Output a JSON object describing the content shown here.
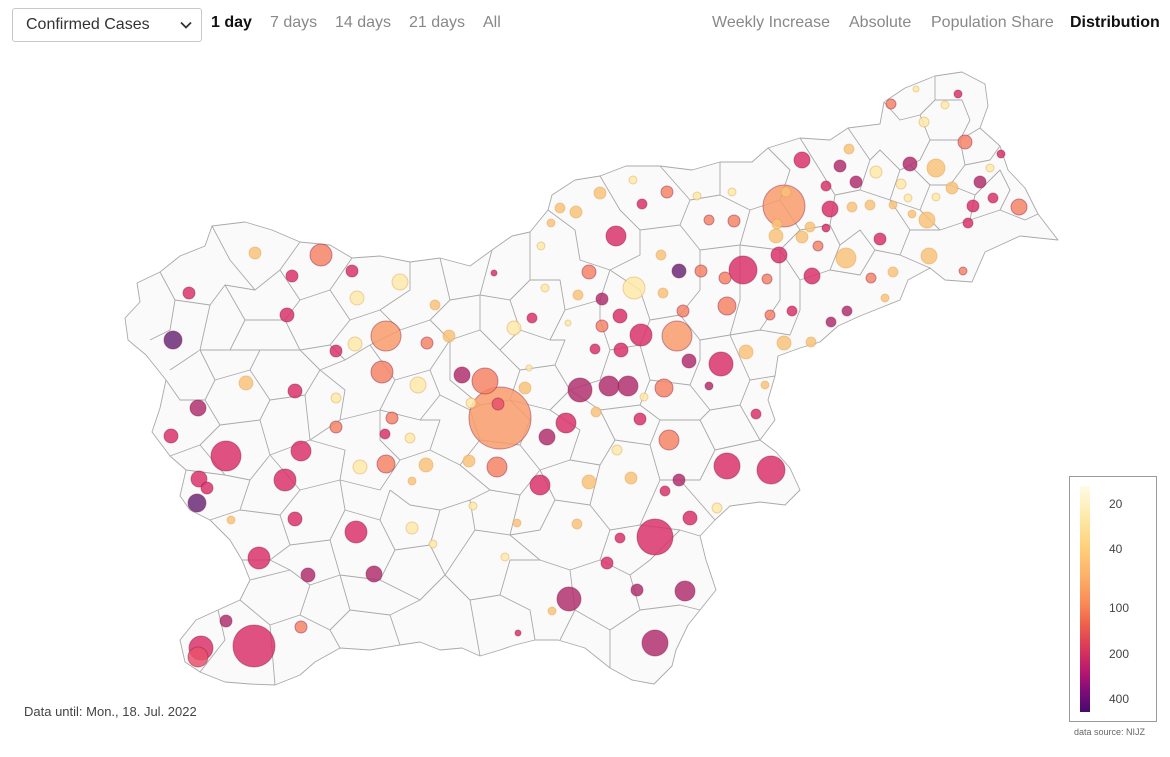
{
  "controls": {
    "metric_select": {
      "value": "Confirmed Cases"
    },
    "period_tabs": [
      {
        "label": "1 day",
        "active": true
      },
      {
        "label": "7 days",
        "active": false
      },
      {
        "label": "14 days",
        "active": false
      },
      {
        "label": "21 days",
        "active": false
      },
      {
        "label": "All",
        "active": false
      }
    ],
    "view_tabs": [
      {
        "label": "Weekly Increase",
        "active": false
      },
      {
        "label": "Absolute",
        "active": false
      },
      {
        "label": "Population Share",
        "active": false
      },
      {
        "label": "Distribution",
        "active": true
      }
    ]
  },
  "map": {
    "legend": {
      "ticks": [
        "20",
        "40",
        "100",
        "200",
        "400"
      ],
      "colors": [
        "#fffbe6",
        "#fed17a",
        "#f98a55",
        "#d9375a",
        "#470a6c"
      ]
    }
  },
  "footer": {
    "data_until": "Data until: Mon., 18. Jul. 2022",
    "source": "data source: NIJZ"
  }
}
